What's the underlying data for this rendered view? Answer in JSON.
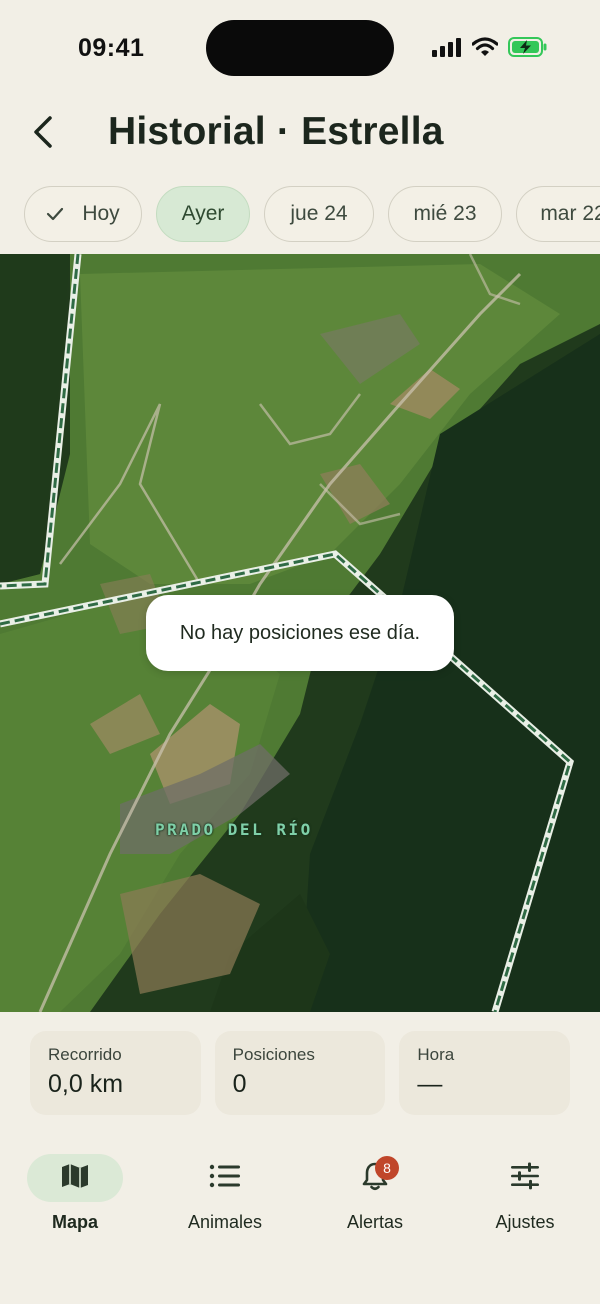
{
  "status_bar": {
    "time": "09:41",
    "icons": [
      "signal-icon",
      "wifi-icon",
      "battery-charging-icon"
    ],
    "battery_color": "#34c759"
  },
  "header": {
    "back_icon": "chevron-left-icon",
    "title": "Historial · Estrella"
  },
  "date_chips": [
    {
      "label": "Hoy",
      "checked": true,
      "selected": false
    },
    {
      "label": "Ayer",
      "checked": false,
      "selected": true
    },
    {
      "label": "jue 24",
      "checked": false,
      "selected": false
    },
    {
      "label": "mié 23",
      "checked": false,
      "selected": false
    },
    {
      "label": "mar 22",
      "checked": false,
      "selected": false
    }
  ],
  "map": {
    "place_label": "PRADO DEL RÍO",
    "geofence_color": "#2f6b45",
    "toast": "No hay posiciones ese día."
  },
  "stats": [
    {
      "label": "Recorrido",
      "value": "0,0 km"
    },
    {
      "label": "Posiciones",
      "value": "0"
    },
    {
      "label": "Hora",
      "value": "—"
    }
  ],
  "tabbar": {
    "accent": "#dbe9d6",
    "badge_color": "#c0462a",
    "tabs": [
      {
        "label": "Mapa",
        "icon": "map-icon",
        "active": true
      },
      {
        "label": "Animales",
        "icon": "list-icon",
        "active": false
      },
      {
        "label": "Alertas",
        "icon": "bell-icon",
        "active": false,
        "badge": "8"
      },
      {
        "label": "Ajustes",
        "icon": "sliders-icon",
        "active": false
      }
    ]
  }
}
